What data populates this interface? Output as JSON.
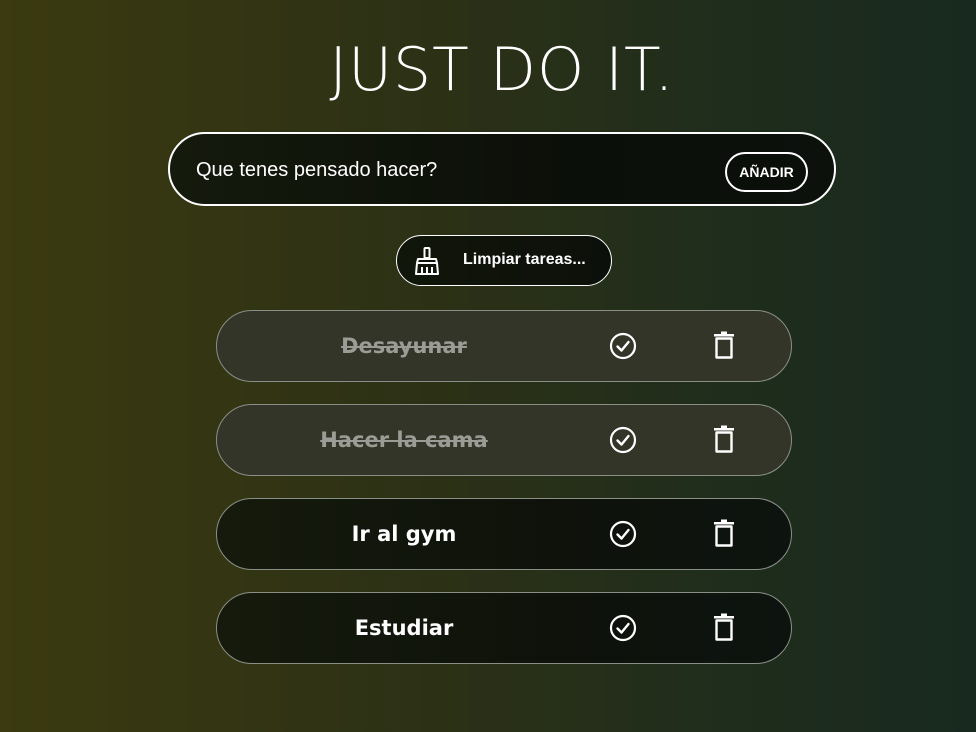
{
  "header": {
    "title": "JUST DO IT."
  },
  "new_task": {
    "placeholder": "Que tenes pensado hacer?",
    "value": "",
    "add_label": "AÑADIR"
  },
  "clear": {
    "label": "Limpiar tareas...",
    "icon": "broom-icon"
  },
  "tasks": [
    {
      "text": "Desayunar",
      "done": true
    },
    {
      "text": "Hacer la cama",
      "done": true
    },
    {
      "text": "Ir al gym",
      "done": false
    },
    {
      "text": "Estudiar",
      "done": false
    }
  ],
  "icons": {
    "complete": "check-circle-icon",
    "delete": "trash-icon"
  },
  "colors": {
    "accent": "#ffffff",
    "done_background": "#323528",
    "done_text": "#9a9c95"
  }
}
